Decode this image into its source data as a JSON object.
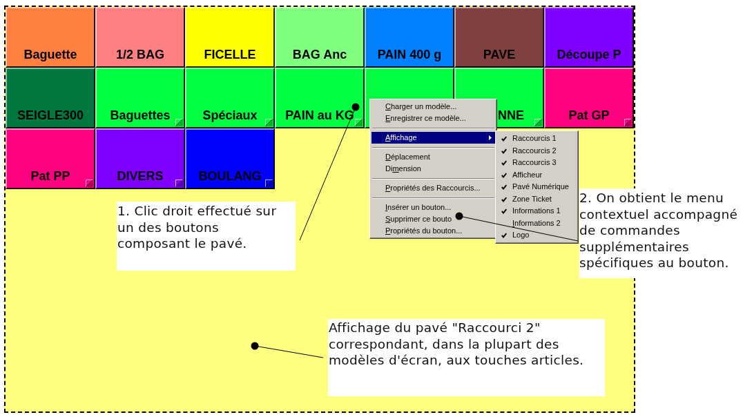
{
  "pad": {
    "buttons": [
      {
        "label": "Baguette",
        "color": "#ff8040",
        "corner_mark": false,
        "label_covered": false
      },
      {
        "label": "1/2 BAG",
        "color": "#ff8080",
        "corner_mark": false,
        "label_covered": false
      },
      {
        "label": "FICELLE",
        "color": "#ffff00",
        "corner_mark": false,
        "label_covered": false
      },
      {
        "label": "BAG Anc",
        "color": "#80ff80",
        "corner_mark": false,
        "label_covered": false
      },
      {
        "label": "PAIN 400 g",
        "color": "#0080ff",
        "corner_mark": false,
        "label_covered": false
      },
      {
        "label": "PAVE",
        "color": "#804040",
        "corner_mark": false,
        "label_covered": false
      },
      {
        "label": "Découpe P",
        "color": "#8000ff",
        "corner_mark": false,
        "label_covered": false
      },
      {
        "label": "SEIGLE300",
        "color": "#007840",
        "corner_mark": false,
        "label_covered": false
      },
      {
        "label": "Baguettes",
        "color": "#00ff40",
        "corner_mark": true,
        "label_covered": false
      },
      {
        "label": "Spéciaux",
        "color": "#00ff40",
        "corner_mark": true,
        "label_covered": false
      },
      {
        "label": "PAIN au KG",
        "color": "#00ff40",
        "corner_mark": true,
        "label_covered": false
      },
      {
        "color": "#00ff40",
        "corner_mark": false
      },
      {
        "label": "NNE",
        "color": "#00ff40",
        "corner_mark": true,
        "label_covered": true
      },
      {
        "label": "Pat GP",
        "color": "#ff0080",
        "corner_mark": true,
        "label_covered": false
      },
      {
        "label": "Pat PP",
        "color": "#ff0080",
        "corner_mark": true,
        "label_covered": false
      },
      {
        "label": "DIVERS",
        "color": "#8000ff",
        "corner_mark": true,
        "label_covered": false
      },
      {
        "label": "BOULANG",
        "color": "#0000ff",
        "corner_mark": true,
        "label_covered": false
      }
    ]
  },
  "context_menu": {
    "groups": [
      {
        "items": [
          {
            "kind": "command",
            "selected": false,
            "access_key": "C",
            "label_after": "harger un modèle..."
          },
          {
            "kind": "command",
            "selected": false,
            "access_key": "E",
            "label_after": "nregistrer ce modèle..."
          }
        ]
      },
      {
        "items": [
          {
            "kind": "submenu",
            "selected": true,
            "access_key": "A",
            "label_after": "ffichage"
          }
        ]
      },
      {
        "items": [
          {
            "kind": "command",
            "selected": false,
            "access_key": "D",
            "label_after": "éplacement"
          },
          {
            "kind": "command",
            "selected": false,
            "label_before": "Di",
            "access_key": "m",
            "label_after": "ension"
          }
        ]
      },
      {
        "items": [
          {
            "kind": "command",
            "selected": false,
            "access_key": "P",
            "label_after": "ropriétés des Raccourcis..."
          }
        ]
      },
      {
        "items": [
          {
            "kind": "command",
            "selected": false,
            "access_key": "I",
            "label_after": "nsérer un bouton..."
          },
          {
            "kind": "command",
            "selected": false,
            "access_key": "S",
            "label_after": "upprimer ce bouto"
          },
          {
            "kind": "command",
            "selected": false,
            "access_key": "P",
            "label_after": "ropriétés du bouton..."
          }
        ]
      }
    ]
  },
  "submenu": {
    "items": [
      {
        "label": "Raccourcis 1",
        "checked": true,
        "selected": false
      },
      {
        "label": "Raccourcis 2",
        "checked": true,
        "selected": false
      },
      {
        "label": "Raccourcis 3",
        "checked": true,
        "selected": false
      },
      {
        "label": "Afficheur",
        "checked": true,
        "selected": false
      },
      {
        "label": "Pavé Numérique",
        "checked": true,
        "selected": false
      },
      {
        "label": "Zone Ticket",
        "checked": true,
        "selected": false
      },
      {
        "label": "Informations 1",
        "checked": true,
        "selected": false
      },
      {
        "access_key": "I",
        "label_after": "nformations 2",
        "checked": false,
        "selected": false
      },
      {
        "label": "Logo",
        "checked": true,
        "selected": false
      }
    ]
  },
  "callouts": [
    {
      "text": "1. Clic droit effectué sur un des boutons composant le pavé."
    },
    {
      "text": "2. On obtient le menu contextuel accompagné de commandes supplémentaires spécifiques au bouton."
    },
    {
      "text": "Affichage du pavé \"Raccourci 2\" correspondant, dans la plupart des modèles d'écran, aux touches articles."
    }
  ]
}
